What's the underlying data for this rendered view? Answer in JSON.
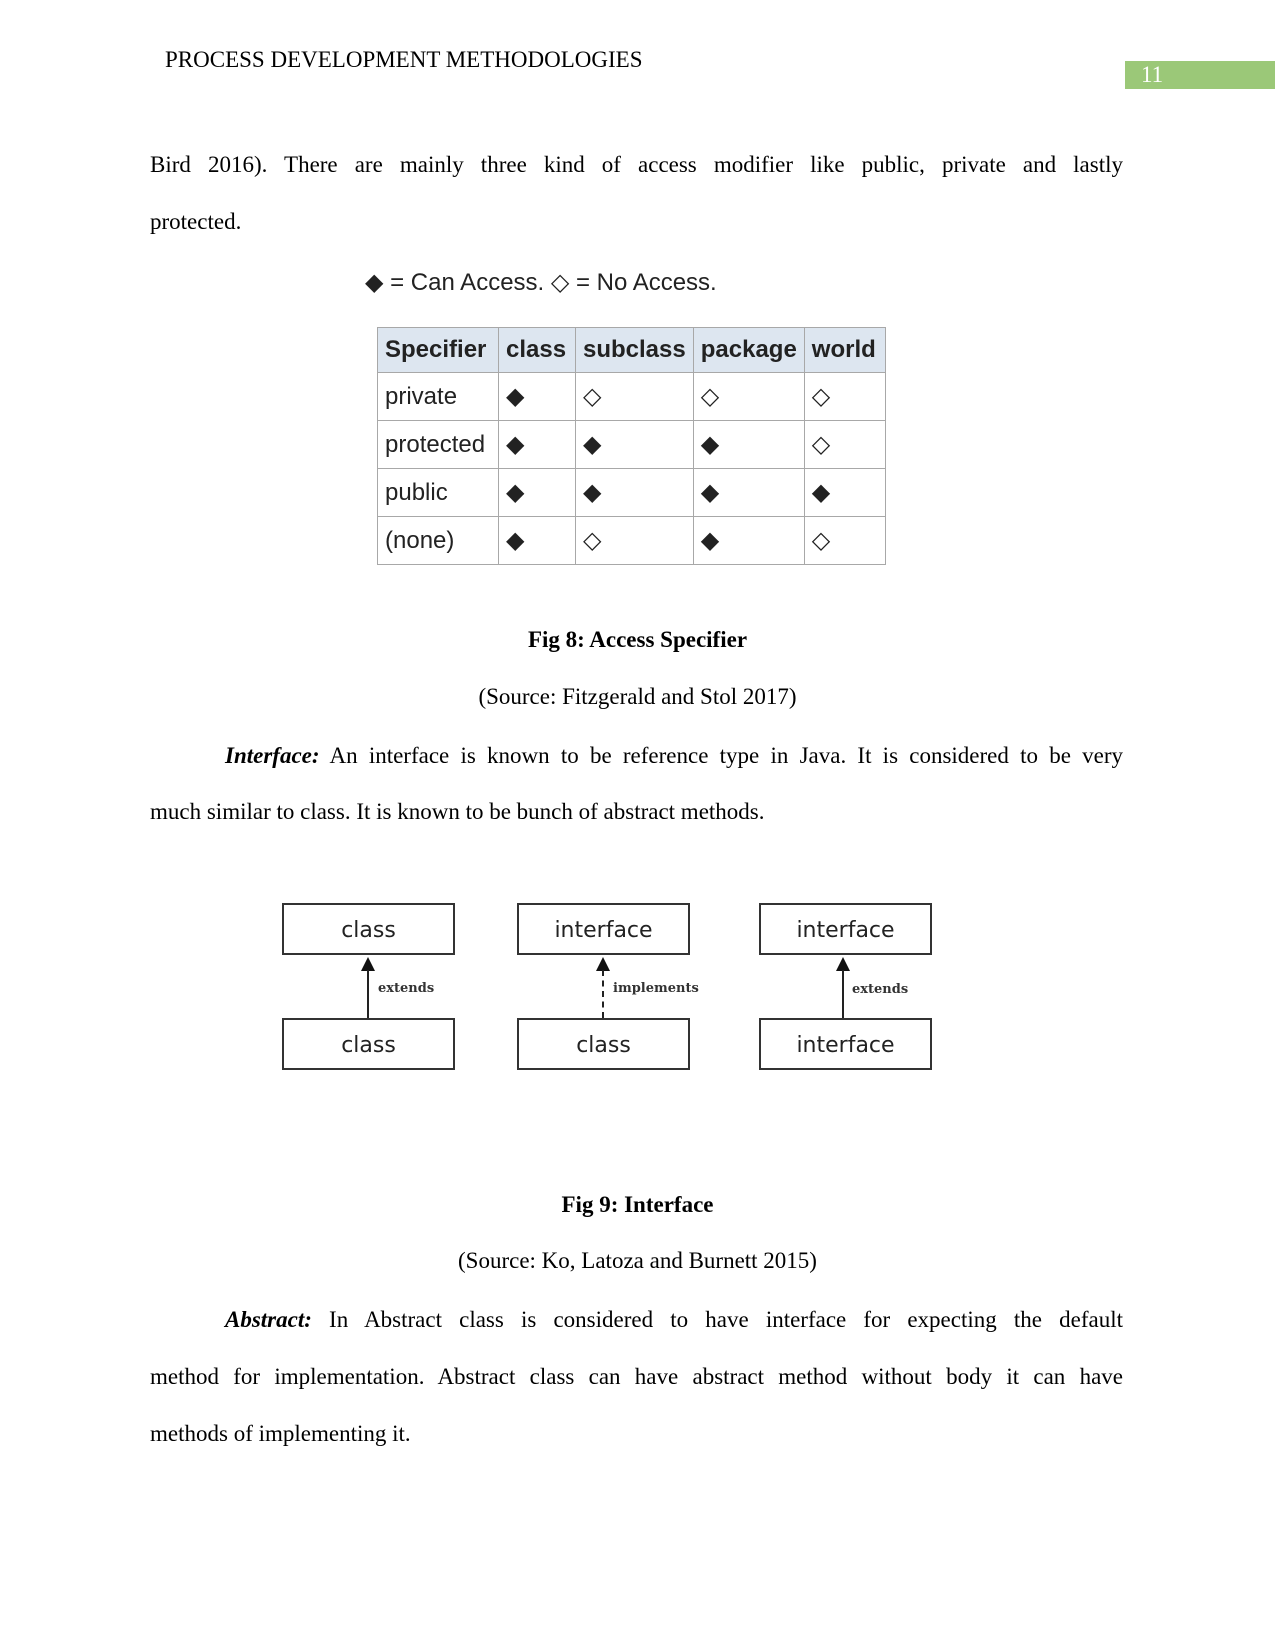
{
  "header": {
    "title": "PROCESS DEVELOPMENT METHODOLOGIES",
    "page_number": "11",
    "accent_color": "#9bc878"
  },
  "intro": {
    "line1": "Bird 2016). There are mainly three kind of access modifier like public, private and lastly",
    "line2": "protected."
  },
  "fig8": {
    "legend": "◆ = Can Access. ◇ = No Access.",
    "table": {
      "headers": [
        "Specifier",
        "class",
        "subclass",
        "package",
        "world"
      ],
      "rows": [
        [
          "private",
          "◆",
          "◇",
          "◇",
          "◇"
        ],
        [
          "protected",
          "◆",
          "◆",
          "◆",
          "◇"
        ],
        [
          "public",
          "◆",
          "◆",
          "◆",
          "◆"
        ],
        [
          "(none)",
          "◆",
          "◇",
          "◆",
          "◇"
        ]
      ]
    },
    "caption": "Fig 8: Access Specifier",
    "source": "(Source: Fitzgerald and Stol 2017)"
  },
  "interface_para": {
    "term": "Interface:",
    "line1_rest": " An interface is known to be reference type in Java. It is considered to be very",
    "line2": "much similar to class. It is known to be bunch of abstract methods."
  },
  "fig9": {
    "diagrams": [
      {
        "top": "class",
        "bottom": "class",
        "relation": "extends"
      },
      {
        "top": "interface",
        "bottom": "class",
        "relation": "implements"
      },
      {
        "top": "interface",
        "bottom": "interface",
        "relation": "extends"
      }
    ],
    "caption": "Fig 9: Interface",
    "source": "(Source: Ko, Latoza and Burnett 2015)"
  },
  "abstract_para": {
    "term": "Abstract:",
    "line1_rest": "  In Abstract class is considered to have interface for expecting the default",
    "line2": "method for implementation. Abstract class can have abstract method without body it can have",
    "line3": "methods of implementing it."
  }
}
